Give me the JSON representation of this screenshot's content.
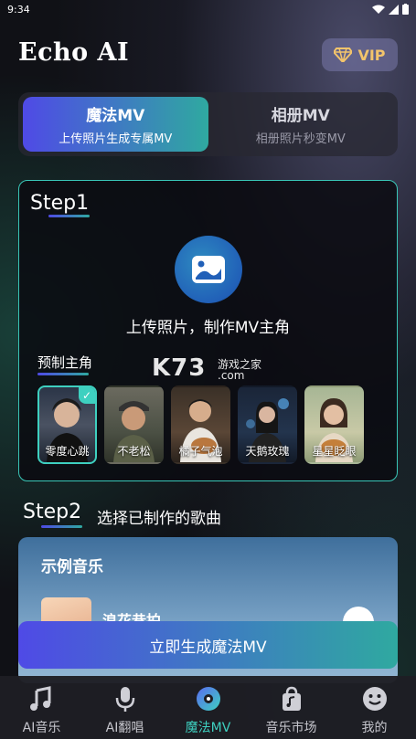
{
  "status_bar": {
    "time": "9:34"
  },
  "app": {
    "title": "Echo AI"
  },
  "vip": {
    "label": "VIP"
  },
  "mode_tabs": [
    {
      "title": "魔法MV",
      "subtitle": "上传照片生成专属MV",
      "active": true
    },
    {
      "title": "相册MV",
      "subtitle": "相册照片秒变MV",
      "active": false
    }
  ],
  "step1": {
    "title": "Step1",
    "upload_label": "上传照片，制作MV主角",
    "preset_title": "预制主角",
    "presets": [
      {
        "name": "零度心跳",
        "selected": true
      },
      {
        "name": "不老松",
        "selected": false
      },
      {
        "name": "橘子气泡",
        "selected": false
      },
      {
        "name": "天鹅玫瑰",
        "selected": false
      },
      {
        "name": "星星眨眼",
        "selected": false
      }
    ]
  },
  "watermark": {
    "big": "K73",
    "small": "游戏之家",
    "dot": ".com"
  },
  "step2": {
    "title": "Step2",
    "subtitle": "选择已制作的歌曲",
    "panel_header": "示例音乐",
    "song_title": "浪花巷拍"
  },
  "generate_button": {
    "label": "立即生成魔法MV"
  },
  "bottom_nav": [
    {
      "label": "AI音乐",
      "icon": "music-note-icon",
      "active": false
    },
    {
      "label": "AI翻唱",
      "icon": "microphone-icon",
      "active": false
    },
    {
      "label": "魔法MV",
      "icon": "magic-disc-icon",
      "active": true
    },
    {
      "label": "音乐市场",
      "icon": "shopping-bag-icon",
      "active": false
    },
    {
      "label": "我的",
      "icon": "smile-face-icon",
      "active": false
    }
  ],
  "colors": {
    "accent_start": "#4f4ae6",
    "accent_end": "#2fa9a0",
    "teal": "#3ed0c0",
    "vip_gold": "#f3c46b"
  }
}
